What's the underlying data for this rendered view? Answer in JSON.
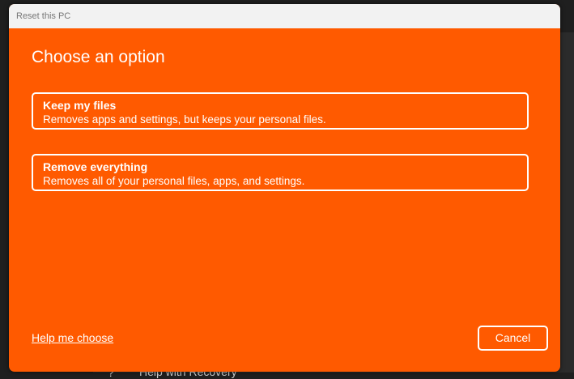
{
  "window": {
    "title": "Reset this PC"
  },
  "dialog": {
    "heading": "Choose an option",
    "options": [
      {
        "title": "Keep my files",
        "description": "Removes apps and settings, but keeps your personal files."
      },
      {
        "title": "Remove everything",
        "description": "Removes all of your personal files, apps, and settings."
      }
    ],
    "help_link": "Help me choose",
    "cancel_label": "Cancel"
  },
  "background": {
    "item_label": "Help with Recovery"
  },
  "colors": {
    "accent": "#ff5a00",
    "titlebar": "#f2f2f2"
  }
}
